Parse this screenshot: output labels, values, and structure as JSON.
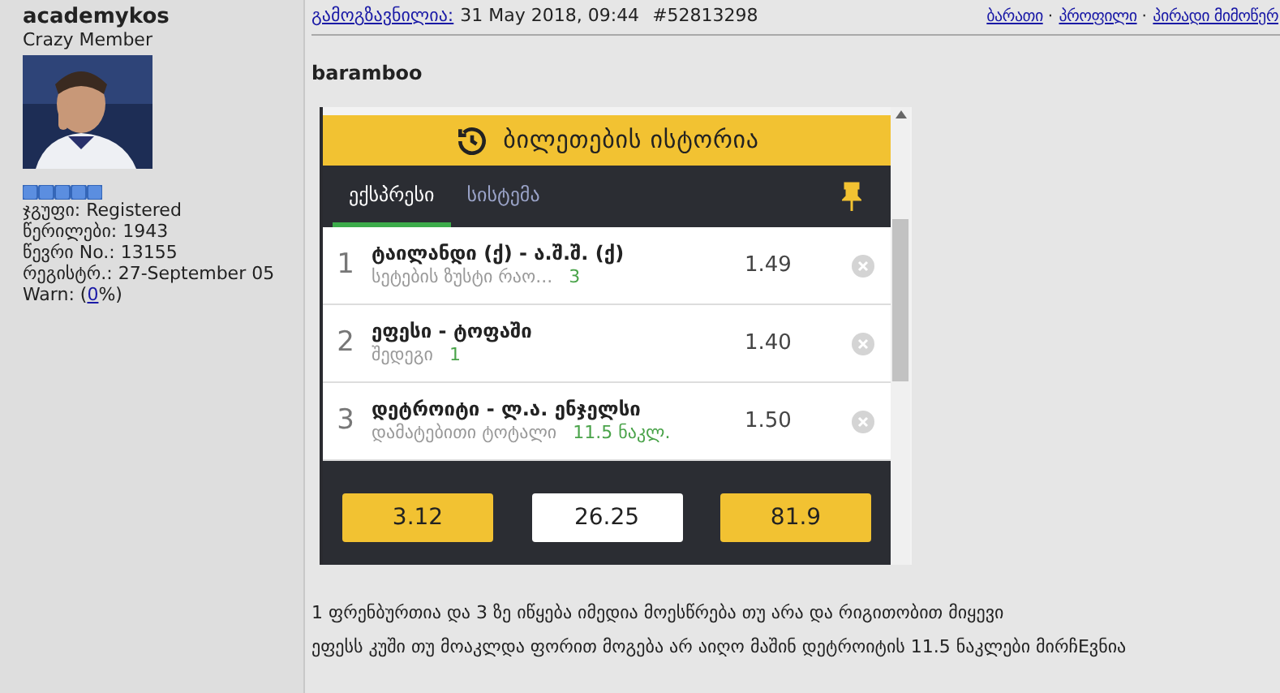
{
  "user": {
    "name": "academykos",
    "rank": "Crazy Member",
    "fields": [
      {
        "label": "ჯგუფი:",
        "value": "Registered"
      },
      {
        "label": "წერილები:",
        "value": "1943"
      },
      {
        "label": "წევრი No.:",
        "value": "13155"
      },
      {
        "label": "რეგისტრ.:",
        "value": "27-September 05"
      }
    ],
    "warn": {
      "label": "Warn:",
      "open": "(",
      "value": "0",
      "close": "%)"
    }
  },
  "post": {
    "posted_label": "გამოგზავნილია:",
    "date": "31 May 2018, 09:44",
    "number": "#52813298",
    "links": [
      "ბარათი",
      "პროფილი",
      "პირადი მიმოწერ"
    ],
    "link_separator": "·",
    "title": "baramboo",
    "app": {
      "header": "ბილეთების ისტორია",
      "tabs": [
        {
          "label": "ექსპრესი",
          "selected": true
        },
        {
          "label": "სისტემა",
          "selected": false
        }
      ],
      "bets": [
        {
          "index": "1",
          "match": "ტაილანდი (ქ) - ა.შ.შ. (ქ)",
          "market": "სეტების ზუსტი რაო...",
          "pick": "3",
          "odds": "1.49"
        },
        {
          "index": "2",
          "match": "ეფესი - ტოფაში",
          "market": "შედეგი",
          "pick": "1",
          "odds": "1.40"
        },
        {
          "index": "3",
          "match": "დეტროიტი - ლ.ა. ენჯელსი",
          "market": "დამატებითი ტოტალი",
          "pick": "11.5 ნაკლ.",
          "odds": "1.50"
        }
      ],
      "totals": [
        {
          "value": "3.12",
          "kind": "accent"
        },
        {
          "value": "26.25",
          "kind": "plain"
        },
        {
          "value": "81.9",
          "kind": "accent"
        }
      ]
    },
    "body": [
      "1 ფრენბურთია და 3 ზე იწყება იმედია მოესწრება თუ არა და რიგითობით მიყევი",
      "ეფესს კუში თუ მოაკლდა ფორით მოგება არ აიღო მაშინ დეტროიტის 11.5 ნაკლები მირჩEვნია"
    ]
  }
}
